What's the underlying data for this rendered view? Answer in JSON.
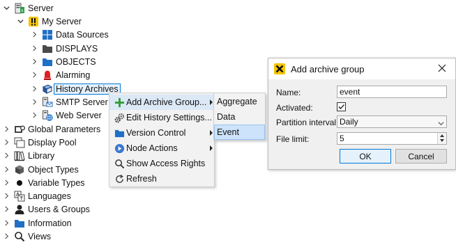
{
  "tree": {
    "items": [
      {
        "label": "Server",
        "icon": "server-icon",
        "expanded": true
      },
      {
        "label": "My Server",
        "icon": "server-warning-icon",
        "expanded": true
      },
      {
        "label": "Data Sources",
        "icon": "grid-icon",
        "expanded": false
      },
      {
        "label": "DISPLAYS",
        "icon": "folder-dark-icon",
        "expanded": false
      },
      {
        "label": "OBJECTS",
        "icon": "folder-blue-icon",
        "expanded": false
      },
      {
        "label": "Alarming",
        "icon": "alarm-bell-icon",
        "expanded": false
      },
      {
        "label": "History Archives",
        "icon": "archive-book-icon",
        "expanded": false,
        "selected": true
      },
      {
        "label": "SMTP Server",
        "icon": "mail-server-icon",
        "expanded": false
      },
      {
        "label": "Web Server",
        "icon": "web-server-icon",
        "expanded": false
      },
      {
        "label": "Global Parameters",
        "icon": "parameters-icon",
        "expanded": false
      },
      {
        "label": "Display Pool",
        "icon": "display-pool-icon",
        "expanded": false
      },
      {
        "label": "Library",
        "icon": "library-icon",
        "expanded": false
      },
      {
        "label": "Object Types",
        "icon": "cube-icon",
        "expanded": false
      },
      {
        "label": "Variable Types",
        "icon": "dot-icon",
        "expanded": false
      },
      {
        "label": "Languages",
        "icon": "languages-icon",
        "expanded": false
      },
      {
        "label": "Users & Groups",
        "icon": "user-icon",
        "expanded": false
      },
      {
        "label": "Information",
        "icon": "folder-blue-icon",
        "expanded": false
      },
      {
        "label": "Views",
        "icon": "search-icon",
        "expanded": false
      }
    ]
  },
  "context_menu": {
    "items": [
      {
        "label": "Add Archive Group...",
        "icon": "plus-icon",
        "has_submenu": true,
        "highlighted": true
      },
      {
        "label": "Edit History Settings...",
        "icon": "gears-icon",
        "has_submenu": false
      },
      {
        "label": "Version Control",
        "icon": "folder-blue-icon",
        "has_submenu": true
      },
      {
        "label": "Node Actions",
        "icon": "node-actions-icon",
        "has_submenu": true
      },
      {
        "label": "Show Access Rights",
        "icon": "search-icon",
        "has_submenu": false
      },
      {
        "label": "Refresh",
        "icon": "refresh-icon",
        "has_submenu": false
      }
    ]
  },
  "submenu": {
    "items": [
      {
        "label": "Aggregate"
      },
      {
        "label": "Data"
      },
      {
        "label": "Event",
        "highlighted": true
      }
    ]
  },
  "dialog": {
    "title": "Add archive group",
    "name_label": "Name:",
    "name_value": "event",
    "activated_label": "Activated:",
    "activated": true,
    "partition_label": "Partition interval:",
    "partition_value": "Daily",
    "file_limit_label": "File limit:",
    "file_limit_value": "5",
    "ok_label": "OK",
    "cancel_label": "Cancel"
  },
  "colors": {
    "selection_border": "#0078d7",
    "menu_highlight": "#dbe8f6",
    "folder_blue": "#1f6fc4",
    "alarm_red": "#e02020",
    "logo_yellow": "#f5c400"
  }
}
